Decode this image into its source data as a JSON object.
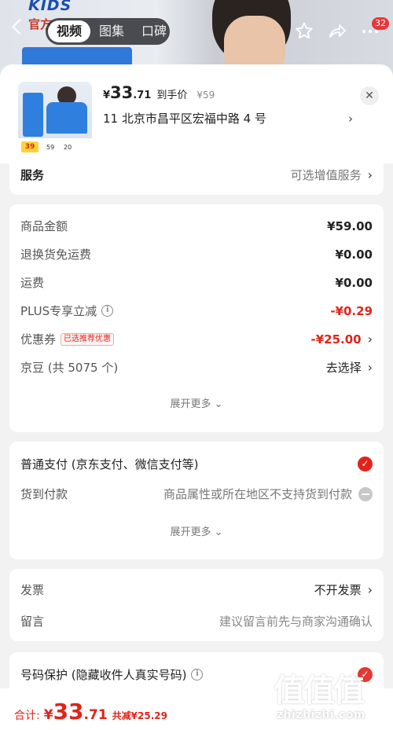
{
  "background": {
    "shop_logo": "KIDS",
    "shop_logo_sub": "官方",
    "tabs": [
      {
        "label": "视频",
        "active": true
      },
      {
        "label": "图集",
        "active": false
      },
      {
        "label": "口碑",
        "active": false
      }
    ],
    "message_badge": "32"
  },
  "sheet_header": {
    "thumbnail": {
      "tag": "39",
      "price_a": "59",
      "price_b": "20"
    },
    "price_currency": "¥",
    "price_integer": "33",
    "price_decimal": ".71",
    "price_label": "到手价",
    "original_price": "¥59",
    "address": "11  北京市昌平区宏福中路 4 号"
  },
  "service": {
    "label": "服务",
    "value": "可选增值服务"
  },
  "amounts": {
    "rows": [
      {
        "label": "商品金额",
        "value": "¥59.00"
      },
      {
        "label": "退换货免运费",
        "value": "¥0.00"
      },
      {
        "label": "运费",
        "value": "¥0.00"
      },
      {
        "label": "PLUS专享立减",
        "value": "-¥0.29"
      },
      {
        "label": "优惠券",
        "tag": "已选推荐优惠",
        "value": "-¥25.00"
      },
      {
        "label": "京豆 (共 5075 个)",
        "value": "去选择"
      }
    ],
    "expand_label": "展开更多"
  },
  "payment": {
    "rows": [
      {
        "label": "普通支付 (京东支付、微信支付等)",
        "selected": true
      },
      {
        "label": "货到付款",
        "note": "商品属性或所在地区不支持货到付款",
        "selected": false
      }
    ],
    "expand_label": "展开更多"
  },
  "extra": {
    "invoice_label": "发票",
    "invoice_value": "不开发票",
    "remark_label": "留言",
    "remark_placeholder": "建议留言前先与商家沟通确认"
  },
  "privacy": {
    "label": "号码保护 (隐藏收件人真实号码)"
  },
  "footer": {
    "total_label": "合计:",
    "total_currency": "¥",
    "total_integer": "33",
    "total_decimal": ".71",
    "savings": "共减¥25.29"
  },
  "watermark": {
    "glyphs": "值值值",
    "url": "zhizhizhi.com"
  },
  "colors": {
    "accent_red": "#e2231a",
    "badge_red": "#e9363a",
    "background": "#f2f2f2"
  }
}
